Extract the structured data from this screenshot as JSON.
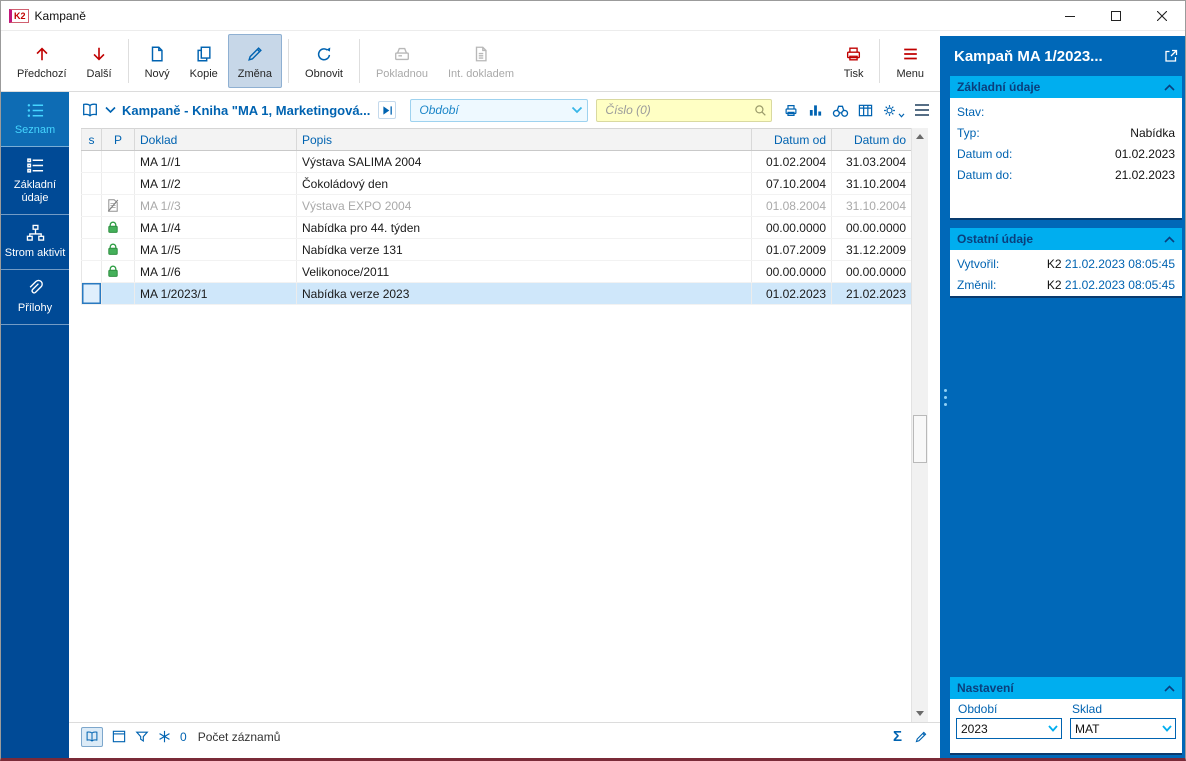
{
  "window": {
    "title": "Kampaně",
    "icon_text": "K2"
  },
  "colors": {
    "accent_red": "#c00000",
    "accent_blue": "#0063b1",
    "sidebar_navy": "#004a96",
    "panel_blue": "#0068b8",
    "section_cyan": "#00aeef",
    "selected_row": "#cfe7fa",
    "search_yellow": "#ffffc4"
  },
  "toolbar": {
    "prev": "Předchozí",
    "next": "Další",
    "new": "Nový",
    "copy": "Kopie",
    "change": "Změna",
    "refresh": "Obnovit",
    "cash": "Pokladnou",
    "intdoc": "Int. dokladem",
    "print": "Tisk",
    "menu": "Menu"
  },
  "sidebar": {
    "items": [
      {
        "label": "Seznam",
        "active": true
      },
      {
        "label": "Základní údaje"
      },
      {
        "label": "Strom aktivit"
      },
      {
        "label": "Přílohy"
      }
    ]
  },
  "browser": {
    "title": "Kampaně - Kniha \"MA 1, Marketingová...",
    "period_placeholder": "Období",
    "number_placeholder": "Číslo (0)",
    "table": {
      "columns": {
        "s": "s",
        "p": "P",
        "doklad": "Doklad",
        "popis": "Popis",
        "datum_od": "Datum od",
        "datum_do": "Datum do"
      },
      "rows": [
        {
          "icon": "none",
          "doklad": "MA 1//1",
          "popis": "Výstava SALIMA 2004",
          "datum_od": "01.02.2004",
          "datum_do": "31.03.2004"
        },
        {
          "icon": "none",
          "doklad": "MA 1//2",
          "popis": "Čokoládový den",
          "datum_od": "07.10.2004",
          "datum_do": "31.10.2004"
        },
        {
          "icon": "cancelled-doc-icon",
          "doklad": "MA 1//3",
          "popis": "Výstava EXPO 2004",
          "datum_od": "01.08.2004",
          "datum_do": "31.10.2004",
          "muted": true
        },
        {
          "icon": "lock-icon",
          "doklad": "MA 1//4",
          "popis": "Nabídka pro 44. týden",
          "datum_od": "00.00.0000",
          "datum_do": "00.00.0000"
        },
        {
          "icon": "lock-icon",
          "doklad": "MA 1//5",
          "popis": "Nabídka verze 131",
          "datum_od": "01.07.2009",
          "datum_do": "31.12.2009"
        },
        {
          "icon": "lock-icon",
          "doklad": "MA 1//6",
          "popis": "Velikonoce/2011",
          "datum_od": "00.00.0000",
          "datum_do": "00.00.0000"
        },
        {
          "icon": "none",
          "doklad": "MA 1/2023/1",
          "popis": "Nabídka verze 2023",
          "datum_od": "01.02.2023",
          "datum_do": "21.02.2023",
          "selected": true
        }
      ]
    },
    "gridbar": {
      "count": "0",
      "records_label": "Počet záznamů"
    }
  },
  "detail": {
    "title": "Kampaň MA 1/2023...",
    "basic": {
      "title": "Základní údaje",
      "fields": [
        {
          "label": "Stav:",
          "value": ""
        },
        {
          "label": "Typ:",
          "value": "Nabídka"
        },
        {
          "label": "Datum od:",
          "value": "01.02.2023"
        },
        {
          "label": "Datum do:",
          "value": "21.02.2023"
        }
      ]
    },
    "other": {
      "title": "Ostatní údaje",
      "fields": [
        {
          "label": "Vytvořil:",
          "user": "K2",
          "time": "21.02.2023 08:05:45"
        },
        {
          "label": "Změnil:",
          "user": "K2",
          "time": "21.02.2023 08:05:45"
        }
      ]
    },
    "settings": {
      "title": "Nastavení",
      "period_label": "Období",
      "period_value": "2023",
      "warehouse_label": "Sklad",
      "warehouse_value": "MAT"
    }
  }
}
